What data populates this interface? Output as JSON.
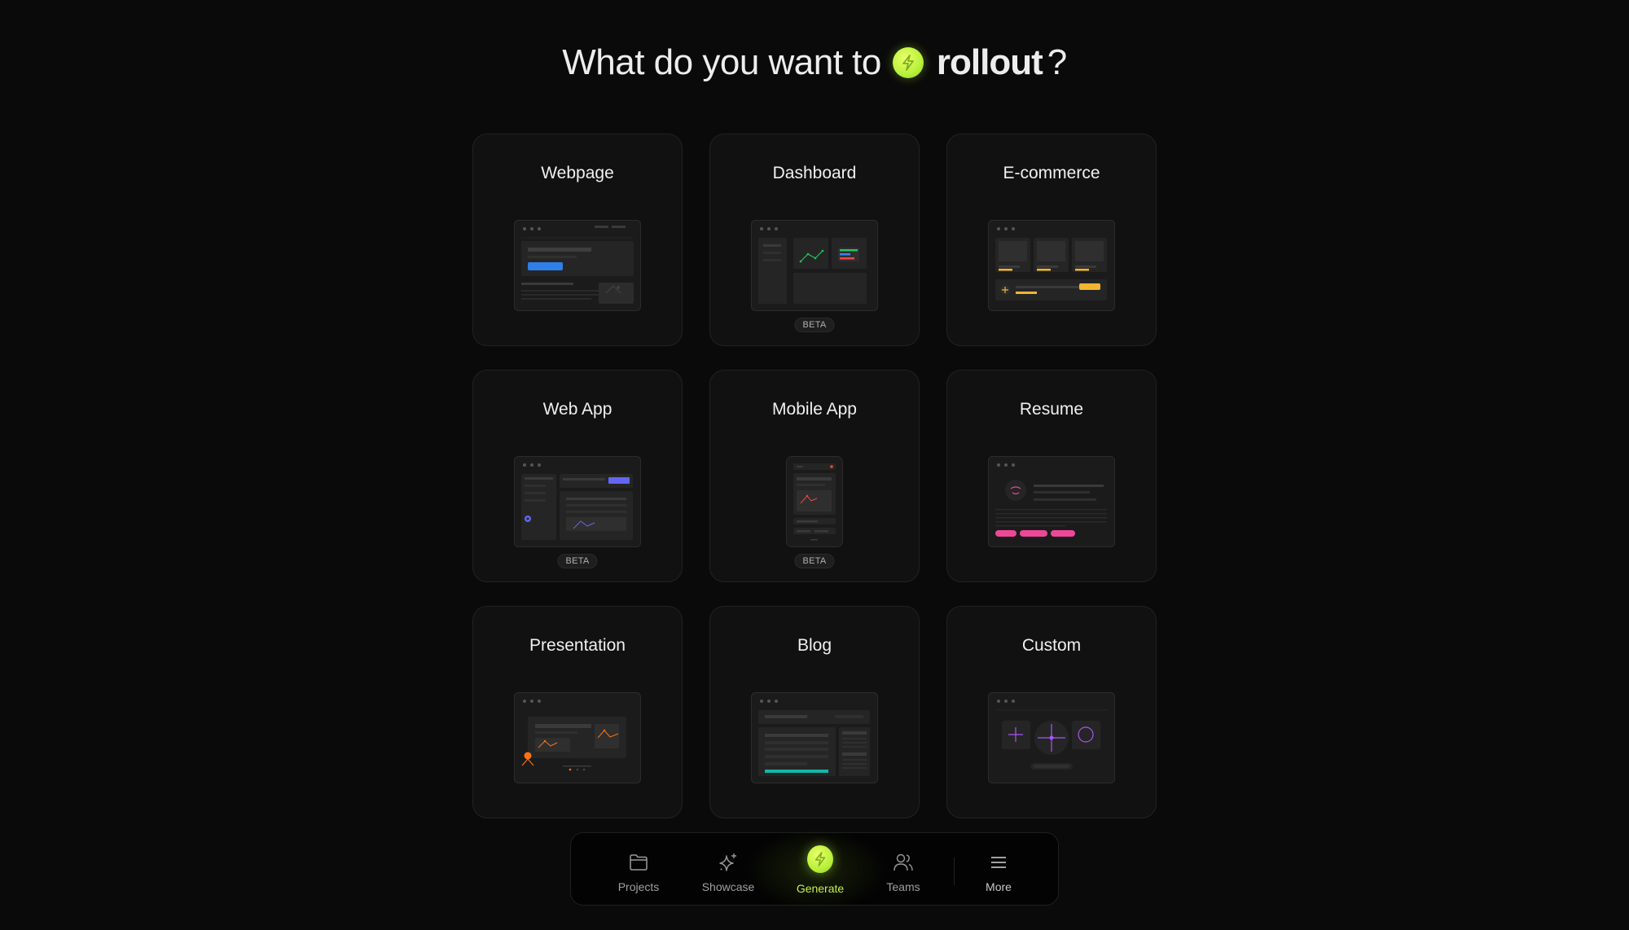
{
  "headline": {
    "prefix": "What do you want to",
    "brand": "rollout",
    "suffix": "?",
    "brand_icon": "bolt-icon",
    "accent_color": "#c6f24a"
  },
  "templates": [
    {
      "label": "Webpage",
      "badge": null,
      "preview": "webpage",
      "accent": "#2f7fe8"
    },
    {
      "label": "Dashboard",
      "badge": "BETA",
      "preview": "dashboard",
      "accent": "#22c55e"
    },
    {
      "label": "E-commerce",
      "badge": null,
      "preview": "ecommerce",
      "accent": "#f2b531"
    },
    {
      "label": "Web App",
      "badge": "BETA",
      "preview": "webapp",
      "accent": "#6366f1"
    },
    {
      "label": "Mobile App",
      "badge": "BETA",
      "preview": "mobile",
      "accent": "#ef4444"
    },
    {
      "label": "Resume",
      "badge": null,
      "preview": "resume",
      "accent": "#ec4899"
    },
    {
      "label": "Presentation",
      "badge": null,
      "preview": "presentation",
      "accent": "#f97316"
    },
    {
      "label": "Blog",
      "badge": null,
      "preview": "blog",
      "accent": "#14b8a6"
    },
    {
      "label": "Custom",
      "badge": null,
      "preview": "custom",
      "accent": "#a855f7"
    }
  ],
  "nav": {
    "items": [
      {
        "label": "Projects",
        "icon": "folder-icon",
        "active": false
      },
      {
        "label": "Showcase",
        "icon": "sparkle-icon",
        "active": false
      },
      {
        "label": "Generate",
        "icon": "bolt-icon",
        "active": true
      },
      {
        "label": "Teams",
        "icon": "users-icon",
        "active": false
      },
      {
        "label": "More",
        "icon": "menu-icon",
        "active": false
      }
    ]
  }
}
